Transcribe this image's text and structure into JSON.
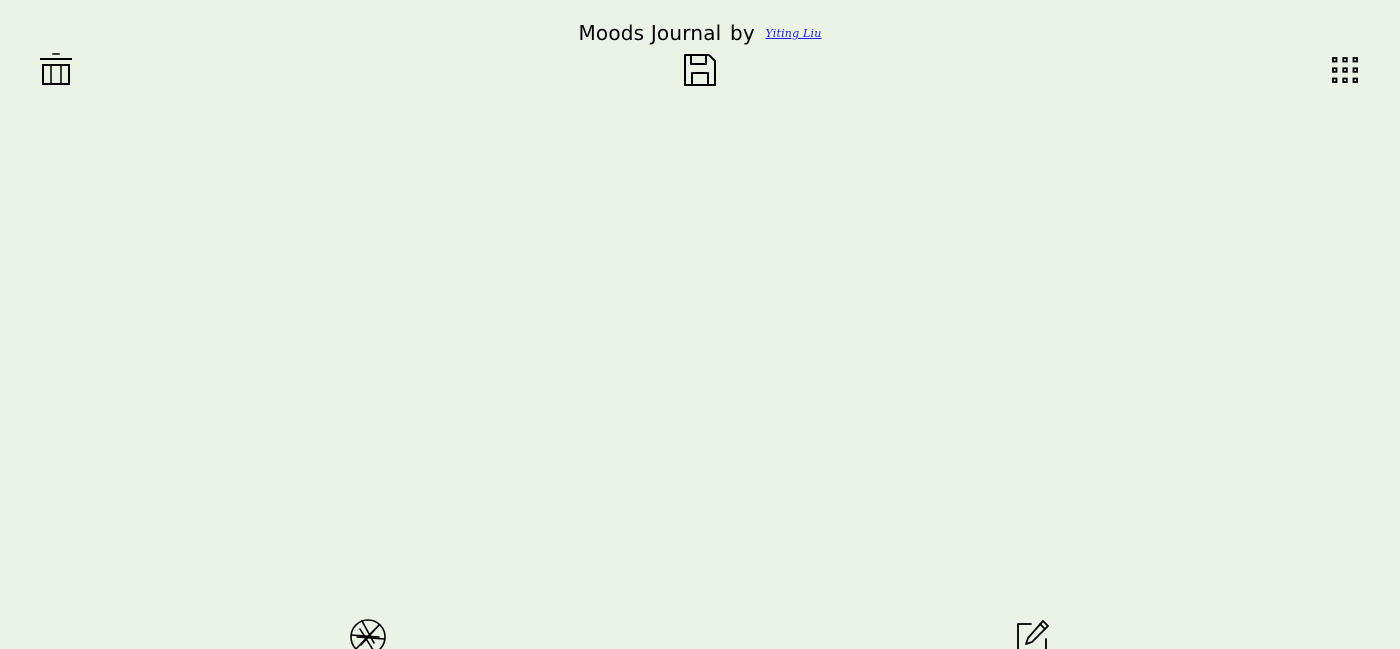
{
  "header": {
    "title": "Moods Journal",
    "by": "by",
    "author_link": "Yiting Liu"
  },
  "toolbar": {
    "left_icon": "trash-icon",
    "center_icon": "save-icon",
    "right_icon": "apps-grid-icon"
  },
  "footer": {
    "left_icon": "camera-aperture-icon",
    "right_icon": "edit-note-icon"
  },
  "colors": {
    "background": "#ebf2e6",
    "text": "#000000",
    "link": "#1a1ae6"
  }
}
